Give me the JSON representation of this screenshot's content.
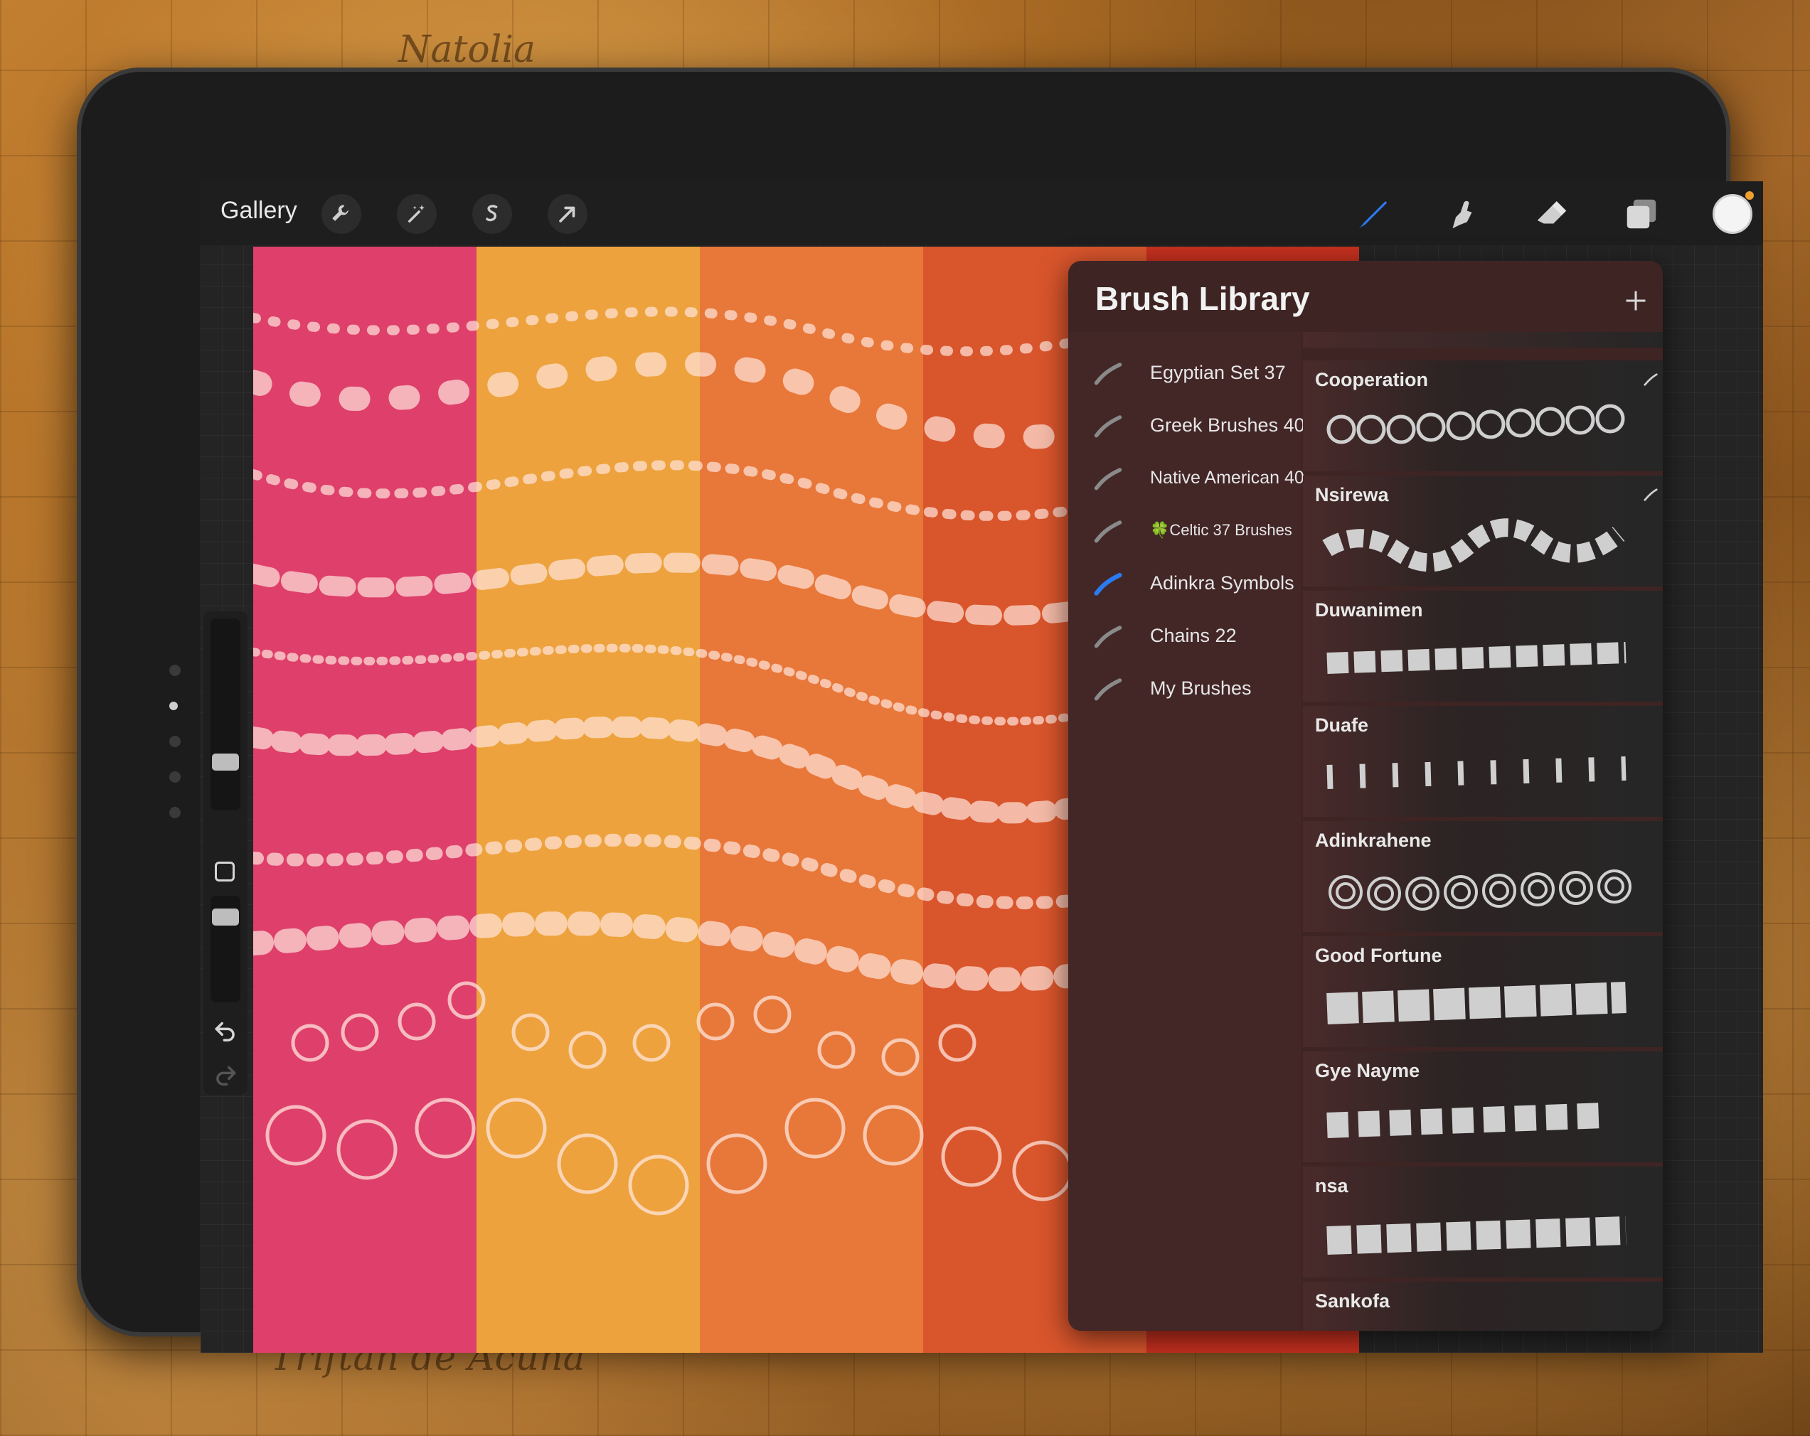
{
  "toolbar": {
    "gallery_label": "Gallery",
    "left_icons": [
      "wrench-icon",
      "magic-wand-icon",
      "selection-icon",
      "transform-arrow-icon"
    ],
    "right_icons": [
      "brush-icon",
      "smudge-icon",
      "eraser-icon",
      "layers-icon",
      "color-swatch"
    ]
  },
  "brush_library": {
    "title": "Brush Library",
    "add_icon": "plus-icon",
    "sets": [
      {
        "label": "Egyptian Set 37",
        "selected": false
      },
      {
        "label": "Greek Brushes 40",
        "selected": false
      },
      {
        "label": "Native American 40",
        "selected": false
      },
      {
        "label": "🍀Celtic 37 Brushes",
        "selected": false
      },
      {
        "label": "Adinkra Symbols",
        "selected": true
      },
      {
        "label": "Chains 22",
        "selected": false
      },
      {
        "label": "My Brushes",
        "selected": false
      }
    ],
    "brushes": [
      {
        "name": "Cooperation"
      },
      {
        "name": "Nsirewa"
      },
      {
        "name": "Duwanimen"
      },
      {
        "name": "Duafe"
      },
      {
        "name": "Adinkrahene"
      },
      {
        "name": "Good Fortune"
      },
      {
        "name": "Gye Nayme"
      },
      {
        "name": "nsa"
      },
      {
        "name": "Sankofa"
      }
    ]
  },
  "canvas": {
    "stripe_colors": [
      "#de3f6b",
      "#eda23d",
      "#e8773a",
      "#d9552c",
      "#c7301f"
    ]
  },
  "colors": {
    "accent_blue": "#2a7bf0",
    "panel_bg": "#3f2424",
    "notification": "#f0a030"
  }
}
